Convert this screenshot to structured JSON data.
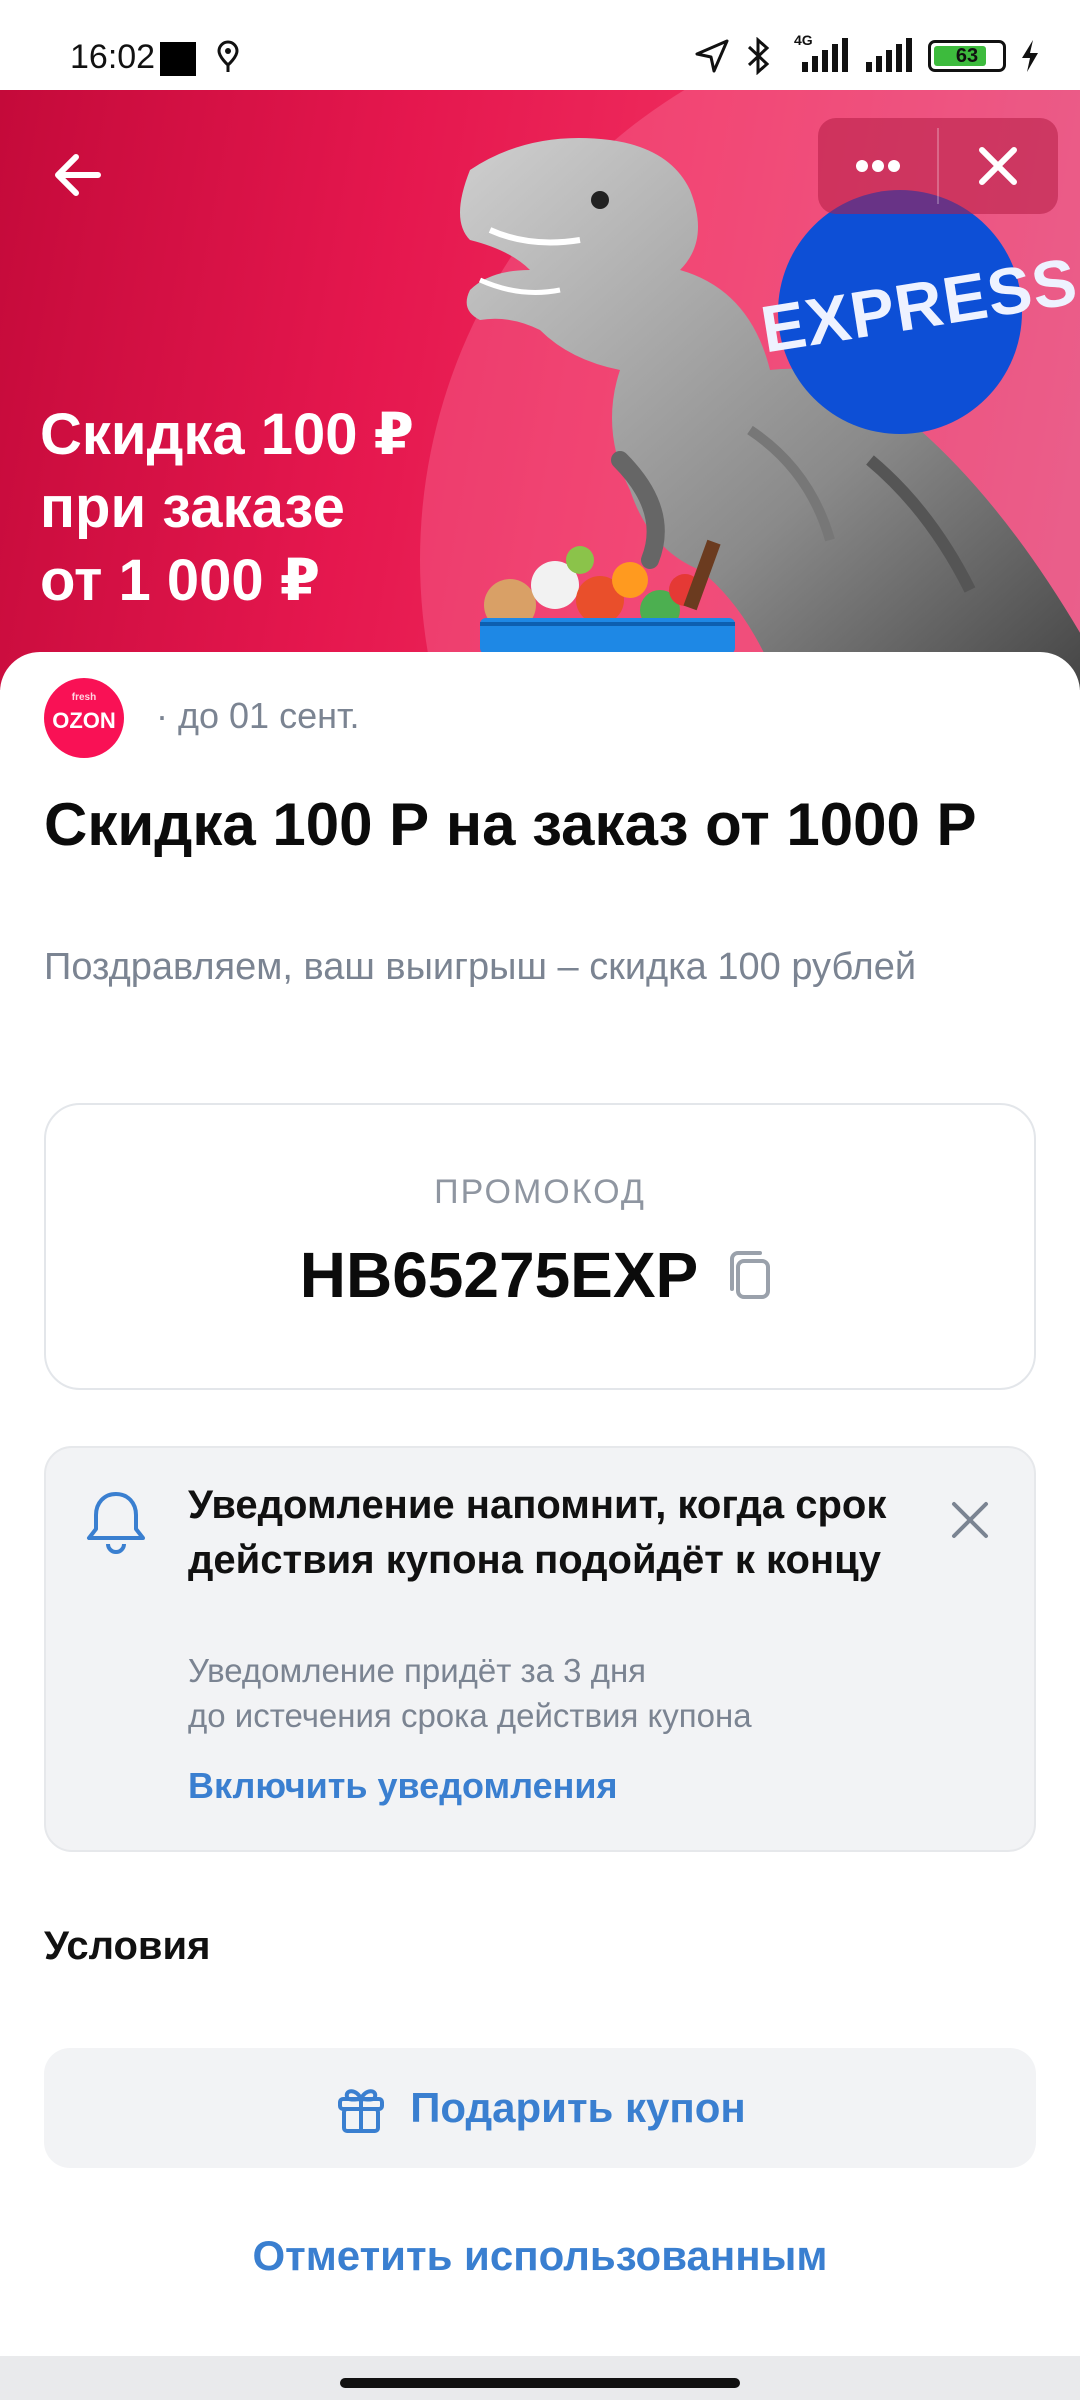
{
  "status_bar": {
    "time": "16:02",
    "network": "4G",
    "battery": "63"
  },
  "banner": {
    "headline_line1": "Скидка 100 ₽",
    "headline_line2": "при заказе",
    "headline_line3": "от 1 000 ₽",
    "badge": "EXPRESS",
    "background_color": "#e5174e",
    "badge_color": "#0d4fd6"
  },
  "top_actions": {
    "back_icon": "arrow-left-icon",
    "more_icon": "more-horizontal-icon",
    "close_icon": "close-icon"
  },
  "coupon": {
    "brand_logo": "OZON",
    "brand_logo_small": "fresh",
    "valid_until": "· до 01 сент.",
    "title": "Скидка 100 Р на заказ от 1000 Р",
    "description": "Поздравляем, ваш выигрыш – скидка 100 рублей"
  },
  "promo": {
    "label": "ПРОМОКОД",
    "code": "HB65275EXP",
    "copy_icon": "copy-icon"
  },
  "notification": {
    "icon": "bell-icon",
    "title": "Уведомление напомнит, когда срок действия купона подойдёт к концу",
    "subtitle_line1": "Уведомление придёт за 3 дня",
    "subtitle_line2": "до истечения срока действия купона",
    "link": "Включить уведомления",
    "close_icon": "close-icon"
  },
  "sections": {
    "conditions": "Условия"
  },
  "actions": {
    "gift_label": "Подарить купон",
    "gift_icon": "gift-icon",
    "mark_used": "Отметить использованным",
    "accent_color": "#3a7fd0"
  }
}
